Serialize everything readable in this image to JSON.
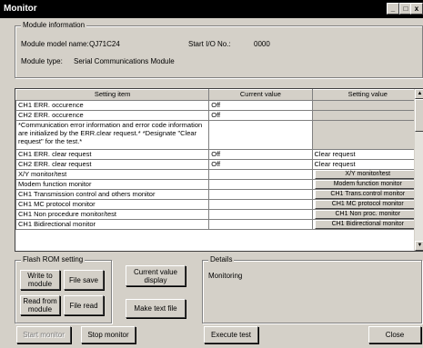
{
  "window": {
    "title": "Monitor",
    "controls": [
      "_",
      "□",
      "x"
    ]
  },
  "module_info": {
    "group_title": "Module information",
    "model_label": "Module model name:",
    "model_value": "QJ71C24",
    "start_io_label": "Start I/O No.:",
    "start_io_value": "0000",
    "type_label": "Module type:",
    "type_value": "Serial Communications Module"
  },
  "table": {
    "headers": [
      "Setting item",
      "Current value",
      "Setting value"
    ],
    "rows": [
      {
        "item": "CH1 ERR. occurence",
        "current": "Off",
        "setting": ""
      },
      {
        "item": "CH2 ERR. occurence",
        "current": "Off",
        "setting": ""
      },
      {
        "item": "*Communication error information and error code information are initialized by the ERR.clear request.* *Designate \"Clear request\" for the test.*",
        "current": "",
        "setting": ""
      },
      {
        "item": "CH1 ERR. clear request",
        "current": "Off",
        "setting": "Clear request"
      },
      {
        "item": "CH2 ERR. clear request",
        "current": "Off",
        "setting": "Clear request"
      },
      {
        "item": "X/Y monitor/test",
        "current": "",
        "setting": "X/Y monitor/test"
      },
      {
        "item": "Modem function monitor",
        "current": "",
        "setting": "Modem function monitor"
      },
      {
        "item": "CH1 Transmission control and others monitor",
        "current": "",
        "setting": "CH1 Trans.control monitor"
      },
      {
        "item": "CH1 MC protocol monitor",
        "current": "",
        "setting": "CH1 MC protocol monitor"
      },
      {
        "item": "CH1 Non procedure monitor/test",
        "current": "",
        "setting": "CH1 Non proc. monitor"
      },
      {
        "item": "CH1 Bidirectional monitor",
        "current": "",
        "setting": "CH1 Bidirectional monitor"
      }
    ]
  },
  "flash_rom": {
    "group_title": "Flash ROM setting",
    "write_to_module": "Write to module",
    "file_save": "File save",
    "read_from_module": "Read from module",
    "file_read": "File read"
  },
  "current_value_display": "Current value display",
  "make_text_file": "Make text file",
  "details": {
    "group_title": "Details",
    "text": "Monitoring"
  },
  "footer": {
    "start_monitor": "Start monitor",
    "stop_monitor": "Stop monitor",
    "execute_test": "Execute test",
    "close": "Close"
  }
}
